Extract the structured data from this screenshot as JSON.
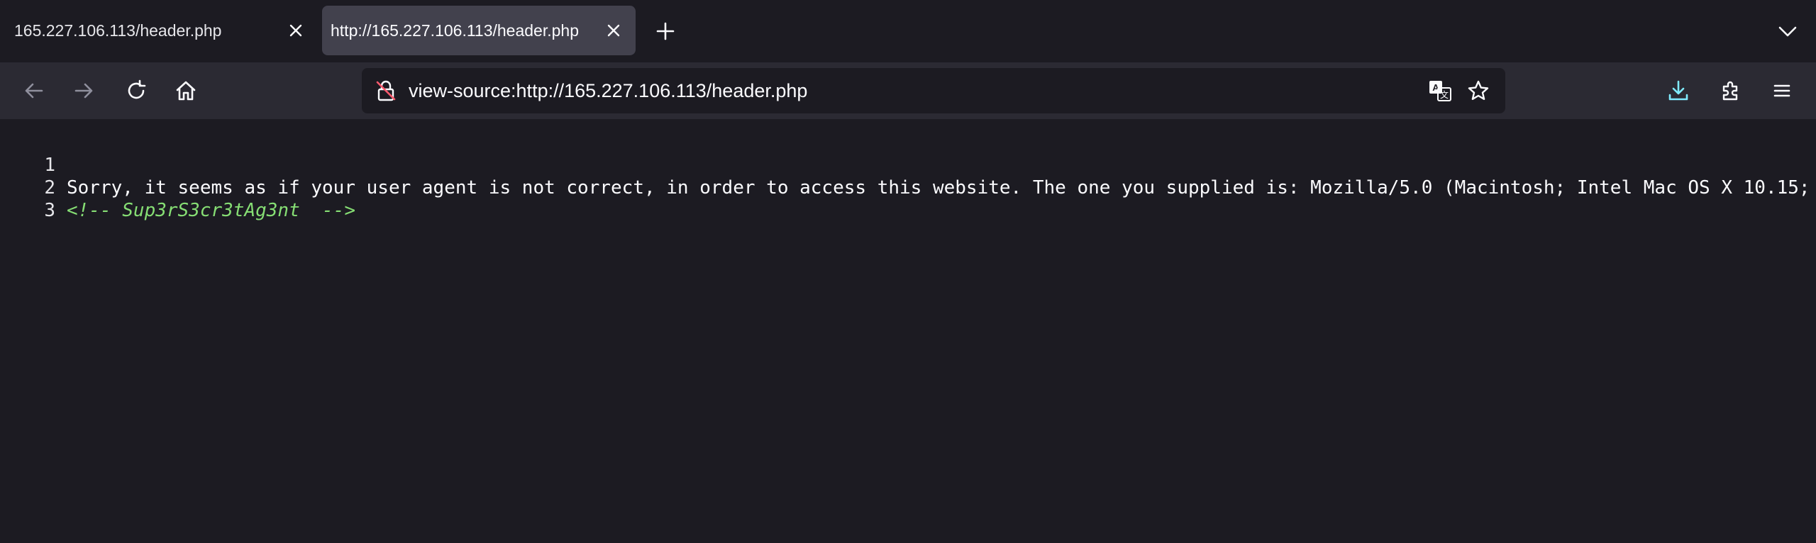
{
  "tabs": [
    {
      "title": "165.227.106.113/header.php",
      "active": false
    },
    {
      "title": "http://165.227.106.113/header.php",
      "active": true
    }
  ],
  "toolbar": {
    "back_icon": "arrow-left-icon",
    "forward_icon": "arrow-right-icon",
    "reload_icon": "reload-icon",
    "home_icon": "home-icon",
    "downloads_icon": "download-icon",
    "extensions_icon": "puzzle-icon",
    "menu_icon": "hamburger-menu-icon"
  },
  "urlbar": {
    "url": "view-source:http://165.227.106.113/header.php",
    "lock_icon": "insecure-lock-icon",
    "translate_icon": "translate-icon",
    "bookmark_icon": "star-icon"
  },
  "source": {
    "lines": [
      {
        "number": "1",
        "text": "Sorry, it seems as if your user agent is not correct, in order to access this website. The one you supplied is: Mozilla/5.0 (Macintosh; Intel Mac OS X 10.15;"
      },
      {
        "number": "2",
        "text": "<!-- Sup3rS3cr3tAg3nt  -->"
      },
      {
        "number": "3",
        "text": ""
      }
    ]
  },
  "colors": {
    "background": "#1c1b22",
    "toolbar": "#2b2a33",
    "active_tab": "#42414d",
    "comment": "#86de74",
    "download_accent": "#80ebff"
  }
}
